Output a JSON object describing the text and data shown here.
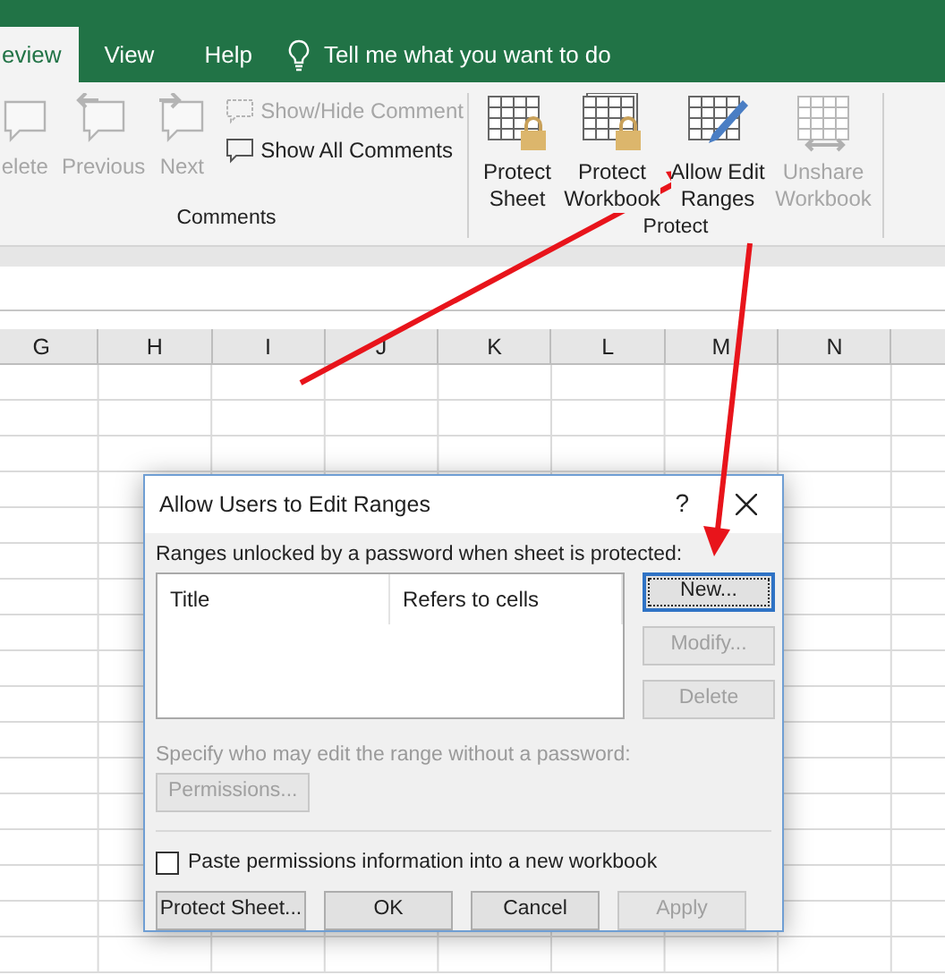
{
  "ribbon_tabs": [
    {
      "label": "eview",
      "selected": true
    },
    {
      "label": "View",
      "selected": false
    },
    {
      "label": "Help",
      "selected": false
    }
  ],
  "tell_me": "Tell me what you want to do",
  "ribbon_groups": [
    {
      "label": "Comments",
      "items": [
        {
          "kind": "comment-delete",
          "lines": [
            "elete"
          ],
          "disabled": true
        },
        {
          "kind": "comment-previous",
          "lines": [
            "Previous"
          ],
          "disabled": true
        },
        {
          "kind": "comment-next",
          "lines": [
            "Next"
          ],
          "disabled": true
        },
        {
          "kind": "comment-toggle",
          "lines": [
            "Show/Hide Comment"
          ],
          "disabled": true
        },
        {
          "kind": "comment-all",
          "lines": [
            "Show All Comments"
          ],
          "disabled": false
        }
      ]
    },
    {
      "label": "Protect",
      "items": [
        {
          "kind": "sheet-lock",
          "lines": [
            "Protect",
            "Sheet"
          ],
          "disabled": false
        },
        {
          "kind": "workbook-lock",
          "lines": [
            "Protect",
            "Workbook"
          ],
          "disabled": false
        },
        {
          "kind": "sheet-pencil",
          "lines": [
            "Allow Edit",
            "Ranges"
          ],
          "disabled": false
        },
        {
          "kind": "workbook-share",
          "lines": [
            "Unshare",
            "Workbook"
          ],
          "disabled": true
        }
      ]
    }
  ],
  "columns": [
    "G",
    "H",
    "I",
    "J",
    "K",
    "L",
    "M",
    "N"
  ],
  "dialog": {
    "title": "Allow Users to Edit Ranges",
    "help": "?",
    "ranges_label": "Ranges unlocked by a password when sheet is protected:",
    "list_columns": [
      "Title",
      "Refers to cells"
    ],
    "side_buttons": [
      {
        "label": "New...",
        "disabled": false,
        "focused": true
      },
      {
        "label": "Modify...",
        "disabled": true,
        "focused": false
      },
      {
        "label": "Delete",
        "disabled": true,
        "focused": false
      }
    ],
    "permissions_label": {
      "text": "Specify who may edit the range without a password:",
      "disabled": true
    },
    "permissions_button": {
      "label": "Permissions...",
      "disabled": true
    },
    "paste_checkbox": {
      "label": "Paste permissions information into a new workbook",
      "checked": false
    },
    "bottom_buttons": [
      {
        "label": "Protect Sheet...",
        "disabled": false
      },
      {
        "label": "OK",
        "disabled": false
      },
      {
        "label": "Cancel",
        "disabled": false
      },
      {
        "label": "Apply",
        "disabled": true
      }
    ]
  }
}
